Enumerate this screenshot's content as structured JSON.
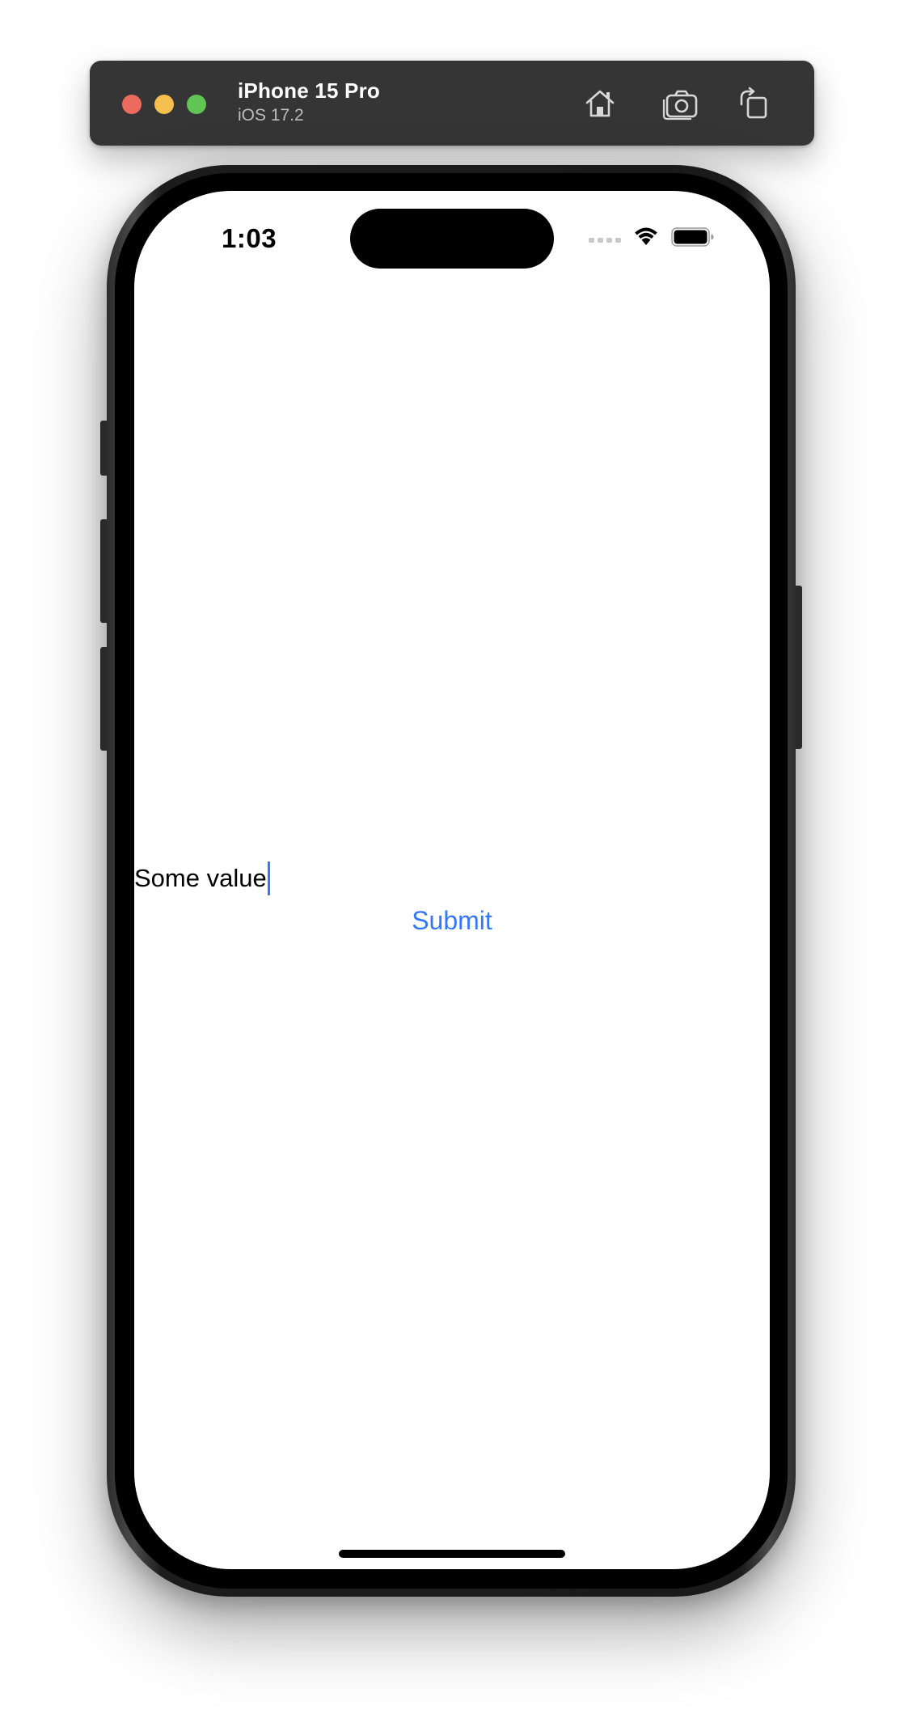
{
  "simulator": {
    "device_name": "iPhone 15 Pro",
    "os_version": "iOS 17.2",
    "toolbar_icons": [
      "home-icon",
      "screenshot-icon",
      "rotate-icon"
    ],
    "traffic_lights": {
      "close": "#ec6a5e",
      "minimize": "#f4bf4f",
      "zoom": "#61c554"
    }
  },
  "status_bar": {
    "time": "1:03",
    "icons": [
      "cellular-signal-icon",
      "wifi-icon",
      "battery-icon"
    ]
  },
  "form": {
    "text_field_value": "Some value",
    "submit_label": "Submit"
  },
  "colors": {
    "accent": "#3478f6",
    "toolbar_bg": "#353535"
  }
}
